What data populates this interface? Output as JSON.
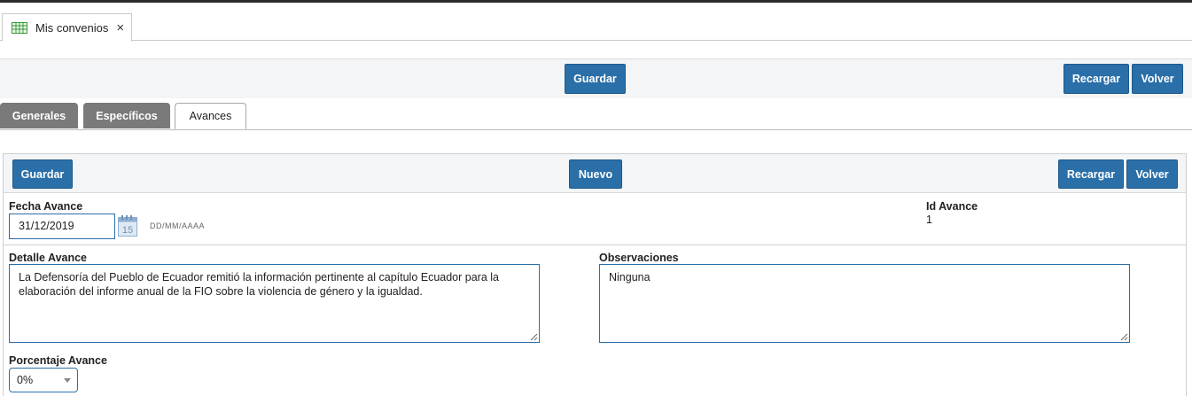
{
  "app_tab": {
    "title": "Mis convenios",
    "icon": "grid-icon",
    "close": "×"
  },
  "main_toolbar": {
    "save": "Guardar",
    "reload": "Recargar",
    "back": "Volver"
  },
  "section_tabs": [
    {
      "label": "Generales",
      "active": false
    },
    {
      "label": "Específicos",
      "active": false
    },
    {
      "label": "Avances",
      "active": true
    }
  ],
  "sub_toolbar": {
    "save": "Guardar",
    "new": "Nuevo",
    "reload": "Recargar",
    "back": "Volver"
  },
  "form": {
    "fecha_avance": {
      "label": "Fecha Avance",
      "value": "31/12/2019",
      "format_hint": "DD/MM/AAAA",
      "calendar_day": "15"
    },
    "id_avance": {
      "label": "Id Avance",
      "value": "1"
    },
    "detalle_avance": {
      "label": "Detalle Avance",
      "value": "La Defensoría del Pueblo de Ecuador remitió la información pertinente al capítulo Ecuador para la elaboración del informe anual de la FIO sobre la violencia de género y la igualdad."
    },
    "observaciones": {
      "label": "Observaciones",
      "value": "Ninguna"
    },
    "porcentaje_avance": {
      "label": "Porcentaje Avance",
      "value": "0%"
    }
  },
  "colors": {
    "primary": "#2a6fa8",
    "tab_inactive": "#7a7a7a",
    "toolbar_bg": "#f4f5f7"
  }
}
